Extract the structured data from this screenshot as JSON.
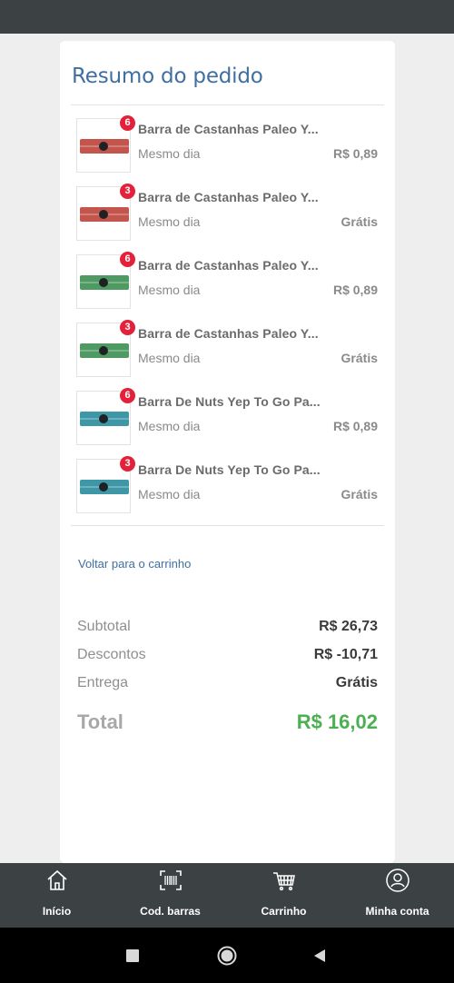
{
  "card": {
    "title": "Resumo do pedido"
  },
  "items": [
    {
      "badge": "6",
      "name": "Barra de Castanhas Paleo Y...",
      "delivery": "Mesmo dia",
      "price": "R$ 0,89",
      "bar_color": "#c3554d"
    },
    {
      "badge": "3",
      "name": "Barra de Castanhas Paleo Y...",
      "delivery": "Mesmo dia",
      "price": "Grátis",
      "bar_color": "#c3554d"
    },
    {
      "badge": "6",
      "name": "Barra de Castanhas Paleo Y...",
      "delivery": "Mesmo dia",
      "price": "R$ 0,89",
      "bar_color": "#4f9a62"
    },
    {
      "badge": "3",
      "name": "Barra de Castanhas Paleo Y...",
      "delivery": "Mesmo dia",
      "price": "Grátis",
      "bar_color": "#4f9a62"
    },
    {
      "badge": "6",
      "name": "Barra De Nuts Yep To Go Pa...",
      "delivery": "Mesmo dia",
      "price": "R$ 0,89",
      "bar_color": "#3e97a6"
    },
    {
      "badge": "3",
      "name": "Barra De Nuts Yep To Go Pa...",
      "delivery": "Mesmo dia",
      "price": "Grátis",
      "bar_color": "#3e97a6"
    }
  ],
  "back_link": "Voltar para o carrinho",
  "totals": {
    "subtotal_label": "Subtotal",
    "subtotal_value": "R$ 26,73",
    "discounts_label": "Descontos",
    "discounts_value": "R$ -10,71",
    "delivery_label": "Entrega",
    "delivery_value": "Grátis",
    "total_label": "Total",
    "total_value": "R$ 16,02"
  },
  "nav": [
    {
      "label": "Início",
      "icon": "home-icon"
    },
    {
      "label": "Cod. barras",
      "icon": "barcode-icon"
    },
    {
      "label": "Carrinho",
      "icon": "cart-icon"
    },
    {
      "label": "Minha conta",
      "icon": "account-icon"
    }
  ],
  "colors": {
    "header_bg": "#3c4244",
    "title_blue": "#3f6fa1",
    "badge_red": "#e4213a",
    "total_green": "#4caf50"
  }
}
